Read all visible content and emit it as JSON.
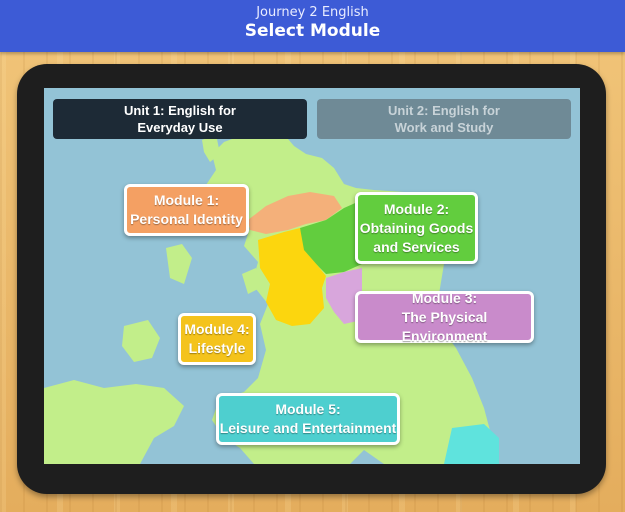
{
  "header": {
    "app_title": "Journey 2 English",
    "page_title": "Select Module"
  },
  "units": [
    {
      "label": "Unit 1: English for\nEveryday Use",
      "state": "selected"
    },
    {
      "label": "Unit 2: English for\nWork and Study",
      "state": "unselected"
    }
  ],
  "modules": [
    {
      "line1": "Module 1:",
      "line2": "Personal Identity",
      "line3": "",
      "color": "#f4a063"
    },
    {
      "line1": "Module 2:",
      "line2": "Obtaining Goods",
      "line3": "and Services",
      "color": "#62cd3e"
    },
    {
      "line1": "Module 3:",
      "line2": "The Physical Environment",
      "line3": "",
      "color": "#c98bcb"
    },
    {
      "line1": "Module 4:",
      "line2": "Lifestyle",
      "line3": "",
      "color": "#f4c31c"
    },
    {
      "line1": "Module 5:",
      "line2": "Leisure and Entertainment",
      "line3": "",
      "color": "#4ecfcf"
    }
  ],
  "colors": {
    "header": "#3d5bd6",
    "sea": "#93c3d6",
    "land": "#c2ee8a",
    "tablet": "#1e1e1e"
  }
}
